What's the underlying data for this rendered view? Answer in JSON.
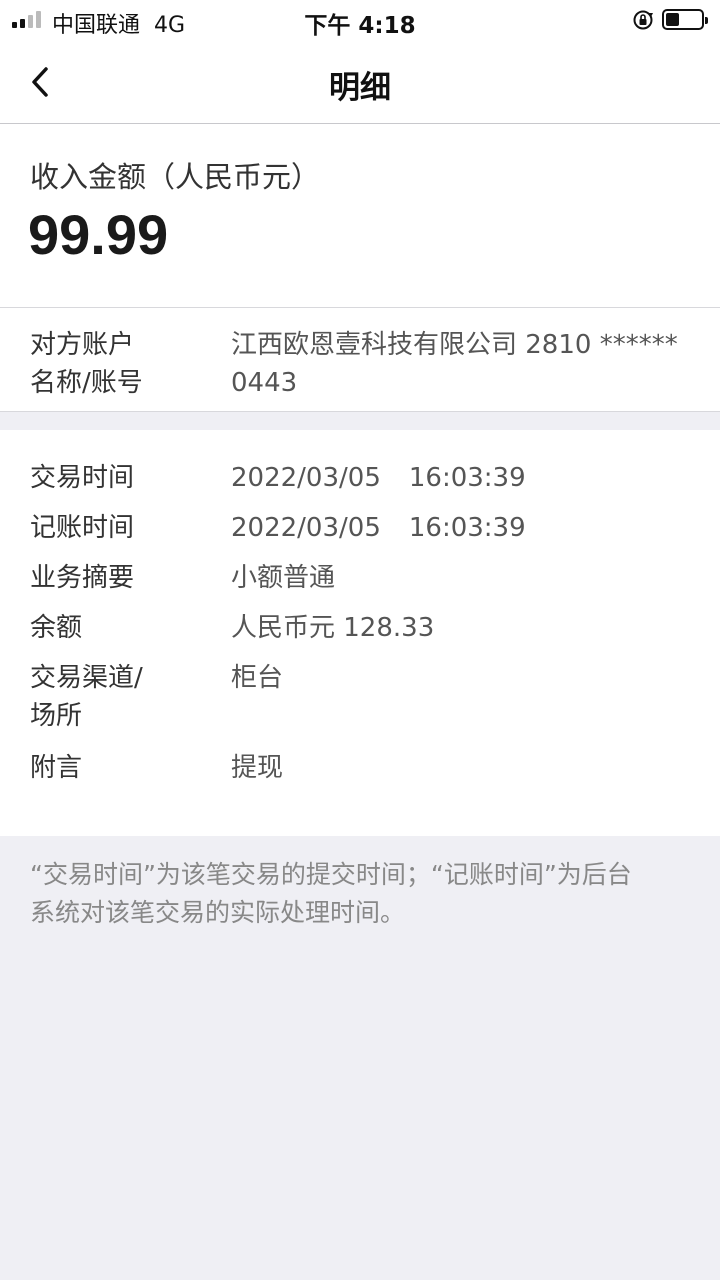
{
  "status_bar": {
    "carrier": "中国联通",
    "network": "4G",
    "time": "下午 4:18",
    "icons": [
      "signal-icon",
      "orientation-lock-icon",
      "battery-icon"
    ]
  },
  "nav": {
    "back_icon": "chevron-left-icon",
    "title": "明细"
  },
  "amount": {
    "label": "收入金额（人民币元）",
    "value": "99.99"
  },
  "counterparty": {
    "label_line1": "对方账户",
    "label_line2": "名称/账号",
    "value_line1": "江西欧恩壹科技有限公司 2810 ******",
    "value_line2": "0443"
  },
  "details": {
    "trade_time": {
      "label": "交易时间",
      "date": "2022/03/05",
      "time": "16:03:39"
    },
    "post_time": {
      "label": "记账时间",
      "date": "2022/03/05",
      "time": "16:03:39"
    },
    "summary": {
      "label": "业务摘要",
      "value": "小额普通"
    },
    "balance": {
      "label": "余额",
      "value": "人民币元 128.33"
    },
    "channel": {
      "label_line1": "交易渠道/",
      "label_line2": "场所",
      "value": "柜台"
    },
    "remark": {
      "label": "附言",
      "value": "提现"
    }
  },
  "note": {
    "line1": "“交易时间”为该笔交易的提交时间；“记账时间”为后台",
    "line2": "系统对该笔交易的实际处理时间。"
  },
  "colors": {
    "page_background": "#efeff4",
    "card_background": "#ffffff",
    "value_text": "#555555",
    "note_text": "#888888"
  }
}
